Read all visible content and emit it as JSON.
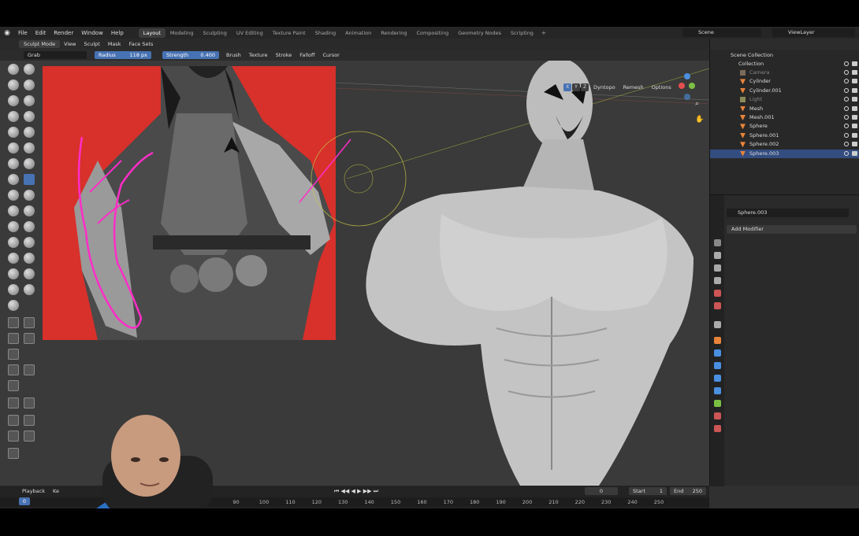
{
  "menubar": {
    "items": [
      "File",
      "Edit",
      "Render",
      "Window",
      "Help"
    ],
    "workspaces": [
      "Layout",
      "Modeling",
      "Sculpting",
      "UV Editing",
      "Texture Paint",
      "Shading",
      "Animation",
      "Rendering",
      "Compositing",
      "Geometry Nodes",
      "Scripting"
    ],
    "active_workspace": "Layout",
    "scene": "Scene",
    "view_layer": "ViewLayer"
  },
  "viewport_header": {
    "mode": "Sculpt Mode",
    "menus": [
      "View",
      "Sculpt",
      "Mask",
      "Face Sets"
    ]
  },
  "tool_settings": {
    "tool": "Grab",
    "radius_label": "Radius",
    "radius_value": "118 px",
    "strength_label": "Strength",
    "strength_value": "0.400",
    "menus": [
      "Brush",
      "Texture",
      "Stroke",
      "Falloff",
      "Cursor"
    ]
  },
  "viewport_right": {
    "axes": [
      "X",
      "Y",
      "Z"
    ],
    "dyntopo": "Dyntopo",
    "remesh": "Remesh",
    "options": "Options"
  },
  "outliner": {
    "root": "Scene Collection",
    "collection": "Collection",
    "items": [
      {
        "name": "Camera",
        "type": "camera",
        "dim": true
      },
      {
        "name": "Cylinder",
        "type": "mesh",
        "dim": false
      },
      {
        "name": "Cylinder.001",
        "type": "mesh",
        "dim": false
      },
      {
        "name": "Light",
        "type": "light",
        "dim": true
      },
      {
        "name": "Mesh",
        "type": "mesh",
        "dim": false
      },
      {
        "name": "Mesh.001",
        "type": "mesh",
        "dim": false
      },
      {
        "name": "Sphere",
        "type": "mesh",
        "dim": false
      },
      {
        "name": "Sphere.001",
        "type": "mesh",
        "dim": false
      },
      {
        "name": "Sphere.002",
        "type": "mesh",
        "dim": false
      },
      {
        "name": "Sphere.003",
        "type": "mesh",
        "dim": false,
        "selected": true
      }
    ]
  },
  "properties": {
    "object_name": "Sphere.003",
    "add_modifier": "Add Modifier"
  },
  "timeline": {
    "playback": "Playback",
    "keying": "Ke",
    "current_frame": "0",
    "frame_box": "0",
    "start_label": "Start",
    "start_value": "1",
    "end_label": "End",
    "end_value": "250",
    "ticks": [
      "0",
      "90",
      "100",
      "110",
      "120",
      "130",
      "140",
      "150",
      "160",
      "170",
      "180",
      "190",
      "200",
      "210",
      "220",
      "230",
      "240",
      "250"
    ]
  },
  "colors": {
    "accent": "#4772b3",
    "reference_bg": "#d8302b",
    "annotation": "#ff2dc8"
  }
}
